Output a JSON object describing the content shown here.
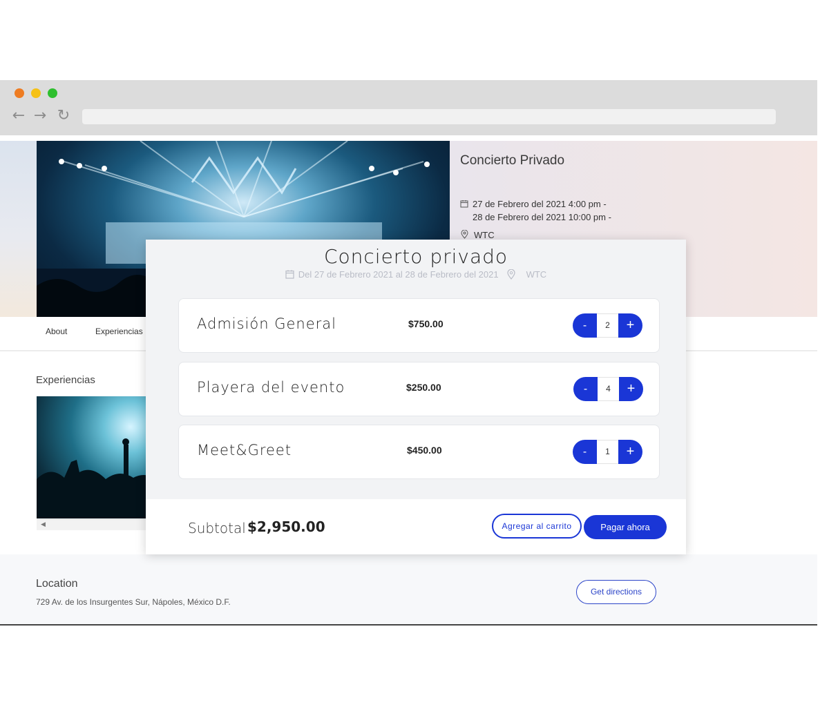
{
  "event": {
    "title": "Concierto Privado",
    "date_start": "27 de Febrero del 2021 4:00 pm -",
    "date_end": "28 de Febrero del 2021 10:00 pm -",
    "venue": "WTC"
  },
  "tabs": [
    {
      "label": "About"
    },
    {
      "label": "Experiencias"
    }
  ],
  "experiences": {
    "title": "Experiencias"
  },
  "location": {
    "title": "Location",
    "address": "729 Av. de los Insurgentes Sur, Nápoles, México D.F.",
    "directions_label": "Get directions"
  },
  "modal": {
    "title": "Concierto privado",
    "date_range": "Del 27 de Febrero 2021 al 28 de Febrero del 2021",
    "venue": "WTC",
    "items": [
      {
        "name": "Admisión General",
        "price": "$750.00",
        "quantity": "2"
      },
      {
        "name": "Playera del evento",
        "price": "$250.00",
        "quantity": "4"
      },
      {
        "name": "Meet&Greet",
        "price": "$450.00",
        "quantity": "1"
      }
    ],
    "minus_label": "-",
    "plus_label": "+",
    "subtotal_label": "Subtotal",
    "subtotal_value": "$2,950.00",
    "add_to_cart_label": "Agregar al carrito",
    "pay_now_label": "Pagar ahora"
  },
  "colors": {
    "accent": "#1a36d6",
    "chrome": "#dcdcdc"
  }
}
